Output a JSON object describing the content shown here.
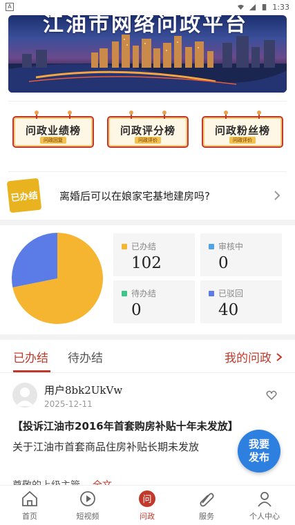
{
  "status_bar": {
    "time": "1:33"
  },
  "banner": {
    "title": "江油市网络问政平台"
  },
  "boards": [
    {
      "label": "问政业绩榜",
      "tag": "问政回复"
    },
    {
      "label": "问政评分榜",
      "tag": "问政评价"
    },
    {
      "label": "问政粉丝榜",
      "tag": "问政评价"
    }
  ],
  "notice": {
    "badge": "已办结",
    "text": "离婚后可以在娘家宅基地建房吗?"
  },
  "stats": {
    "items": [
      {
        "label": "已办结",
        "value": "102",
        "color": "#F5B531"
      },
      {
        "label": "审核中",
        "value": "0",
        "color": "#4FA3E8"
      },
      {
        "label": "待办结",
        "value": "0",
        "color": "#3CC68A"
      },
      {
        "label": "已驳回",
        "value": "40",
        "color": "#5B7BE6"
      }
    ]
  },
  "tabs": {
    "done": "已办结",
    "pending": "待办结",
    "mine": "我的问政"
  },
  "post": {
    "username": "用户8bk2UkVw",
    "date": "2025-12-11",
    "title": "【投诉江油市2016年首套购房补贴十年未发放】",
    "body": "关于江油市首套商品住房补贴长期未发放",
    "foot_text": "尊敬的上级主管",
    "foot_more": "全文"
  },
  "fab": {
    "line1": "我要",
    "line2": "发布"
  },
  "nav": [
    {
      "label": "首页",
      "icon": "home-icon"
    },
    {
      "label": "短视频",
      "icon": "play-icon"
    },
    {
      "label": "问政",
      "icon": "ask-icon"
    },
    {
      "label": "服务",
      "icon": "service-icon"
    },
    {
      "label": "个人中心",
      "icon": "user-icon"
    }
  ],
  "colors": {
    "accent": "#C0392B",
    "fab": "#2D7FE0"
  }
}
